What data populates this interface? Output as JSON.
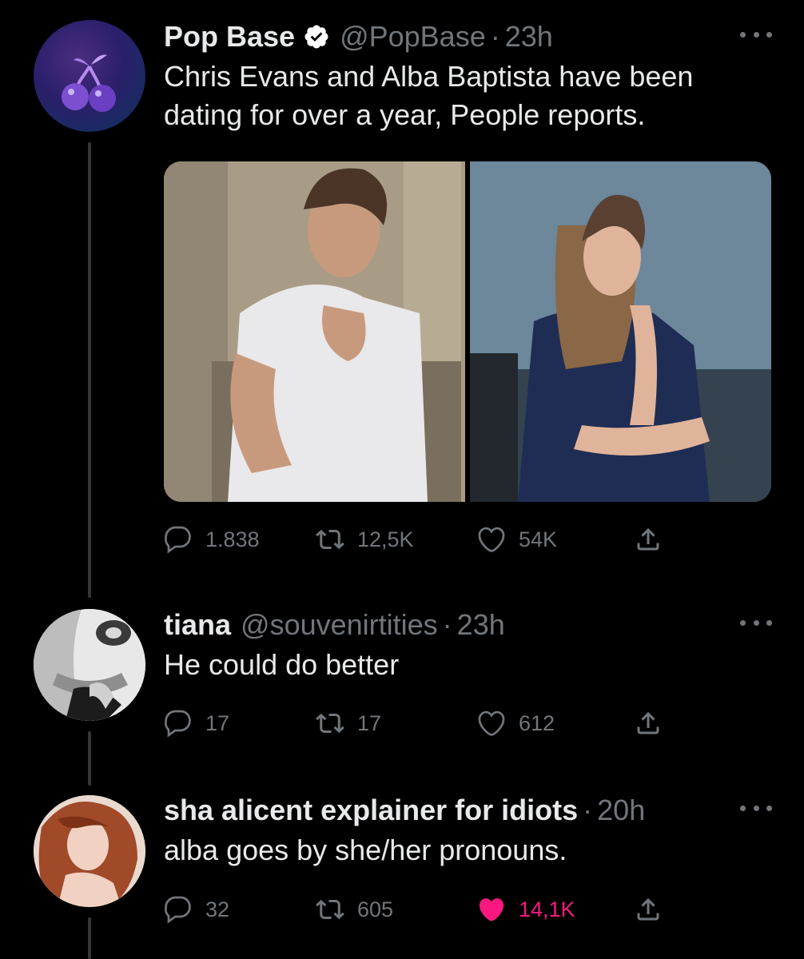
{
  "tweets": [
    {
      "name": "Pop Base",
      "handle": "@PopBase",
      "separator": "·",
      "time": "23h",
      "text": "Chris Evans and Alba Baptista have been dating for over a year, People reports.",
      "avatar_icon": "cherry-icon",
      "verified": true,
      "actions": {
        "replies": "1.838",
        "retweets": "12,5K",
        "likes": "54K"
      }
    },
    {
      "name": "tiana",
      "handle": "@souvenirtities",
      "separator": "·",
      "time": "23h",
      "text": "He could do better",
      "actions": {
        "replies": "17",
        "retweets": "17",
        "likes": "612"
      }
    },
    {
      "name": "sha alicent explainer for idiots",
      "handle": "",
      "separator": "·",
      "time": "20h",
      "text": "alba goes by she/her pronouns.",
      "actions": {
        "replies": "32",
        "retweets": "605",
        "likes": "14,1K"
      },
      "liked": true
    }
  ],
  "colors": {
    "background": "#000000",
    "text": "#e7e9ea",
    "muted": "#71767b",
    "like_active": "#f91880",
    "verified": "#ffffff"
  }
}
